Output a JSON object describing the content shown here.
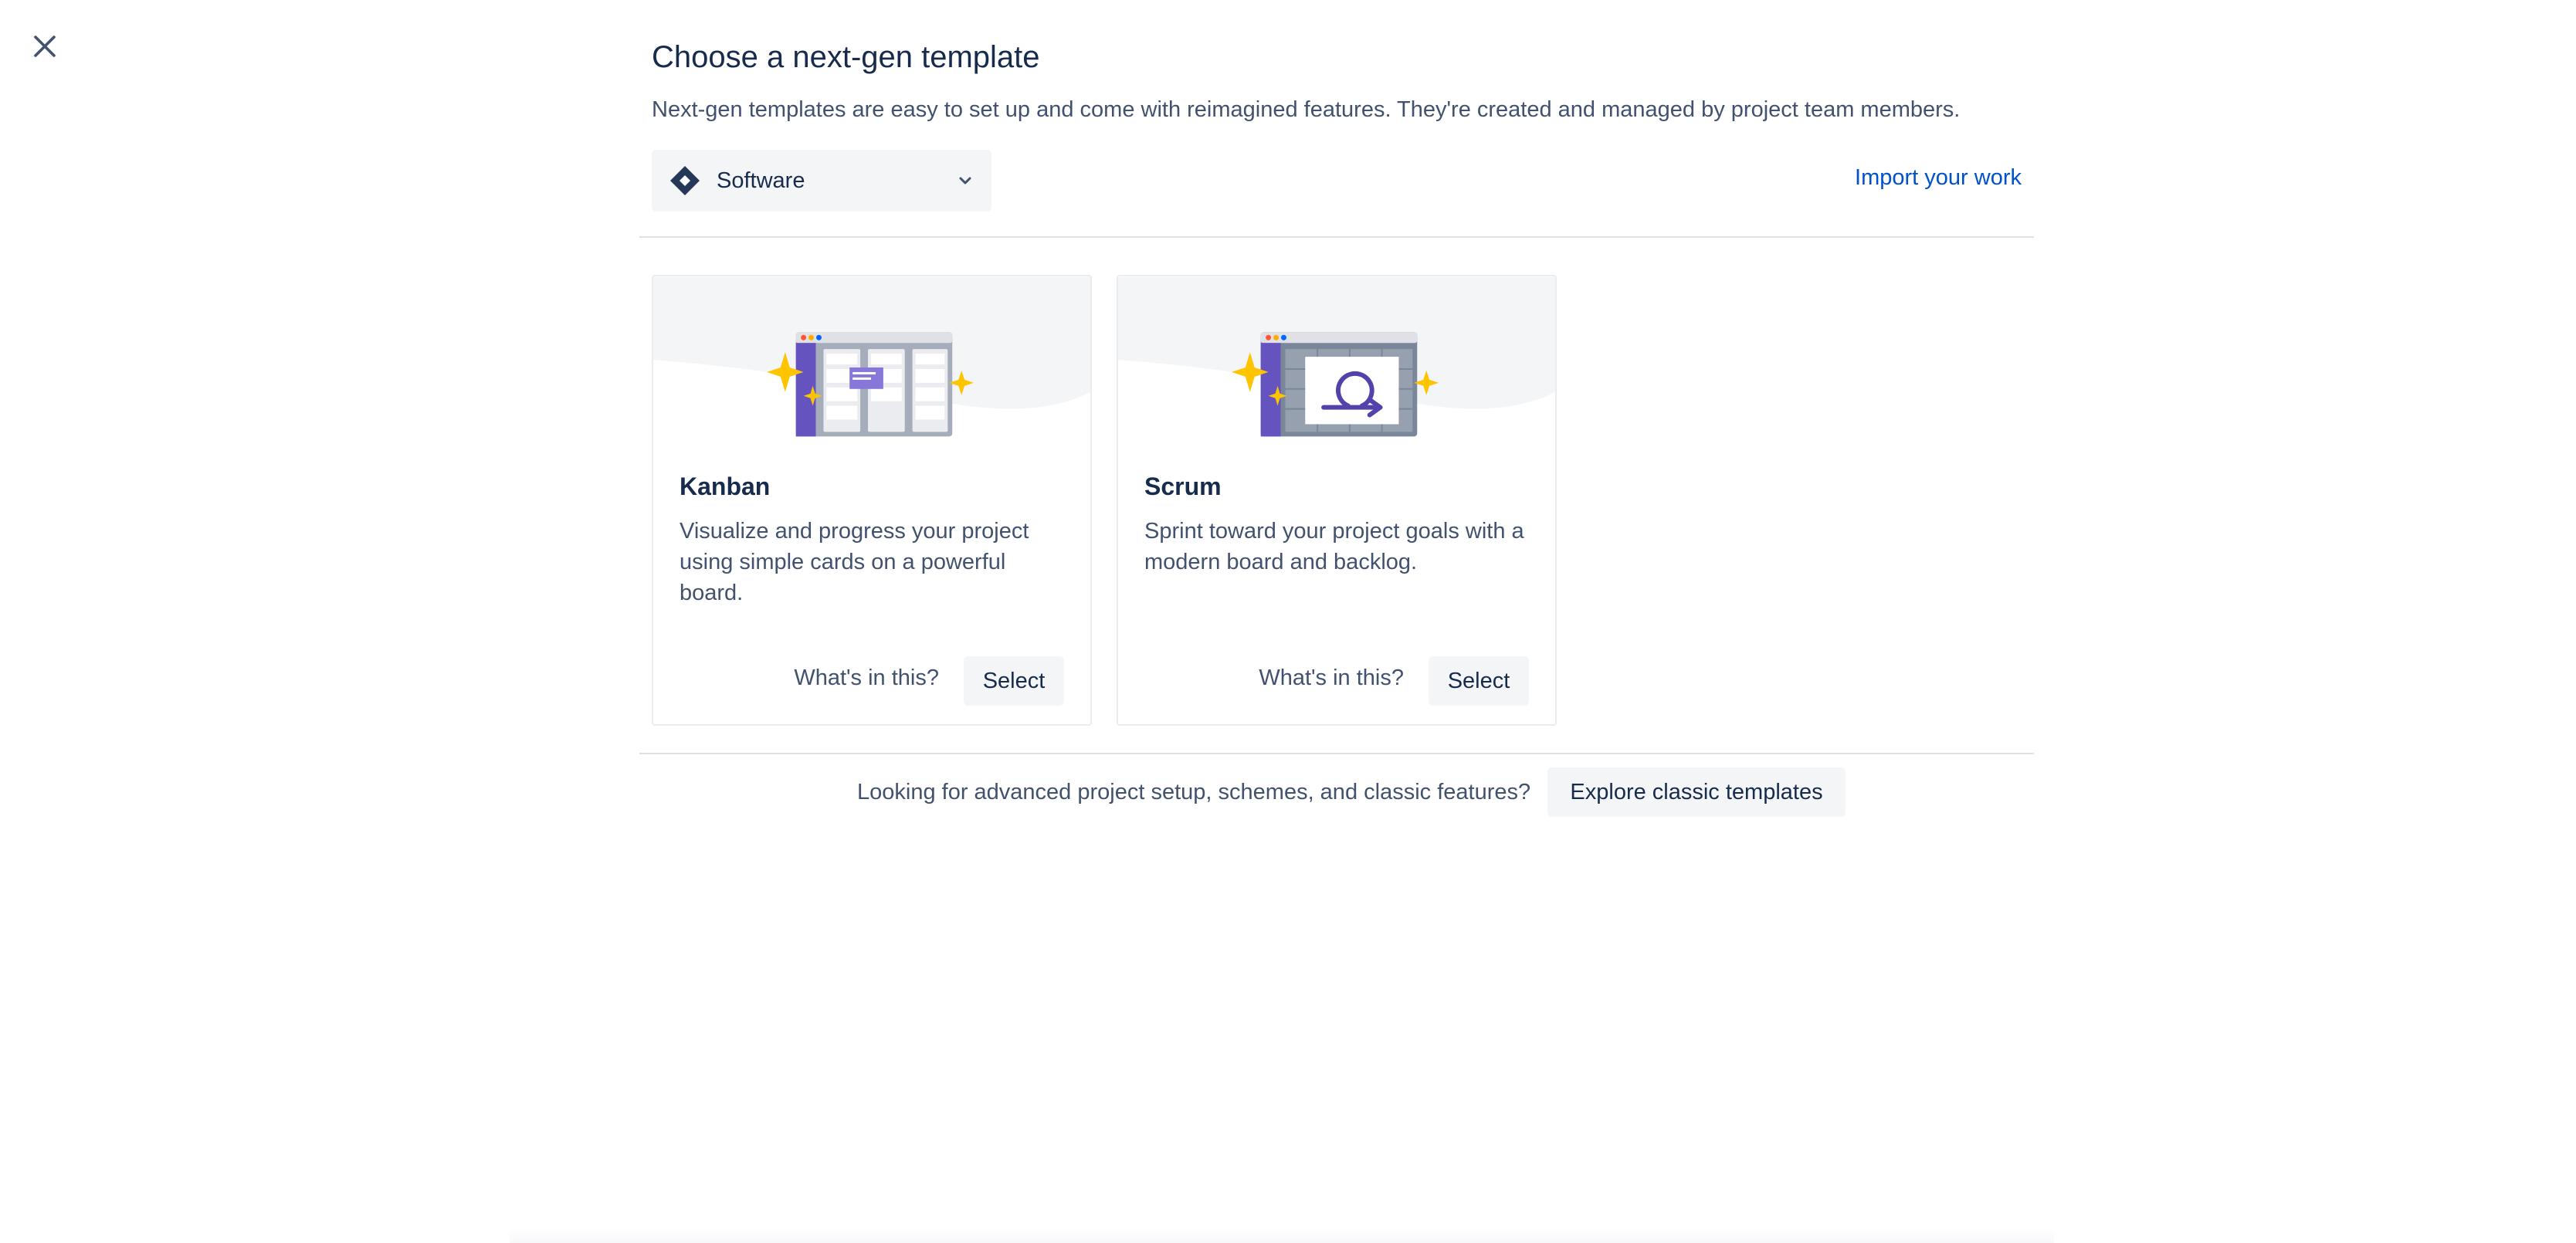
{
  "header": {
    "title": "Choose a next-gen template",
    "subtitle": "Next-gen templates are easy to set up and come with reimagined features. They're created and managed by project team members."
  },
  "product_select": {
    "icon": "jira-software-icon",
    "value": "Software"
  },
  "import_link": "Import your work",
  "templates": [
    {
      "name": "Kanban",
      "description": "Visualize and progress your project using simple cards on a powerful board.",
      "whats_in": "What's in this?",
      "select": "Select",
      "illustration": "kanban-board-illustration"
    },
    {
      "name": "Scrum",
      "description": "Sprint toward your project goals with a modern board and backlog.",
      "whats_in": "What's in this?",
      "select": "Select",
      "illustration": "scrum-sprint-illustration"
    }
  ],
  "footer": {
    "text": "Looking for advanced project setup, schemes, and classic features?",
    "button": "Explore classic templates"
  },
  "colors": {
    "text_primary": "#172B4D",
    "text_secondary": "#42526E",
    "link": "#0052CC",
    "button_bg": "#F4F5F7",
    "purple": "#6554C0",
    "yellow": "#FFC400"
  }
}
